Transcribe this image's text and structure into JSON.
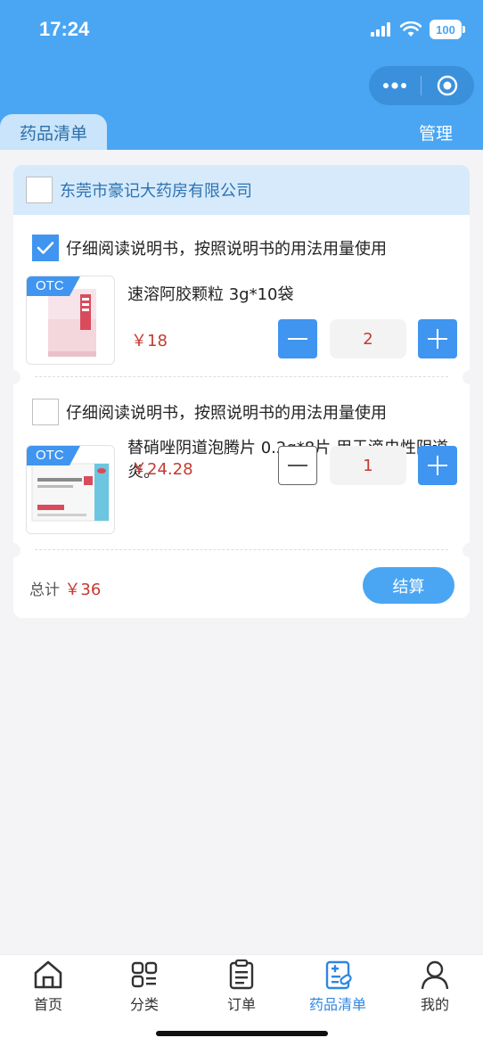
{
  "status_bar": {
    "time": "17:24",
    "battery": "100"
  },
  "header": {
    "active_tab": "药品清单",
    "manage_label": "管理"
  },
  "store": {
    "name": "东莞市豪记大药房有限公司",
    "checked": false
  },
  "items": [
    {
      "notice": "仔细阅读说明书，按照说明书的用法用量使用",
      "checked": true,
      "badge": "OTC",
      "name": "速溶阿胶颗粒 3g*10袋",
      "price": "￥18",
      "quantity": "2",
      "image_icon": "medicine-box-pink-icon"
    },
    {
      "notice": "仔细阅读说明书，按照说明书的用法用量使用",
      "checked": false,
      "badge": "OTC",
      "name": "替硝唑阴道泡腾片 0.2g*8片 用于滴虫性阴道炎。",
      "price": "￥24.28",
      "quantity": "1",
      "image_icon": "medicine-box-white-icon"
    }
  ],
  "summary": {
    "total_label": "总计",
    "total_amount": "￥36",
    "checkout_label": "结算"
  },
  "tabbar": [
    {
      "label": "首页",
      "icon": "home-icon"
    },
    {
      "label": "分类",
      "icon": "category-icon"
    },
    {
      "label": "订单",
      "icon": "order-icon"
    },
    {
      "label": "药品清单",
      "icon": "medicine-list-icon",
      "active": true
    },
    {
      "label": "我的",
      "icon": "profile-icon"
    }
  ],
  "colors": {
    "brand": "#4aa6f3",
    "accent": "#3f95f0",
    "price": "#c53a31",
    "active_tab_text": "#2f86e0"
  }
}
